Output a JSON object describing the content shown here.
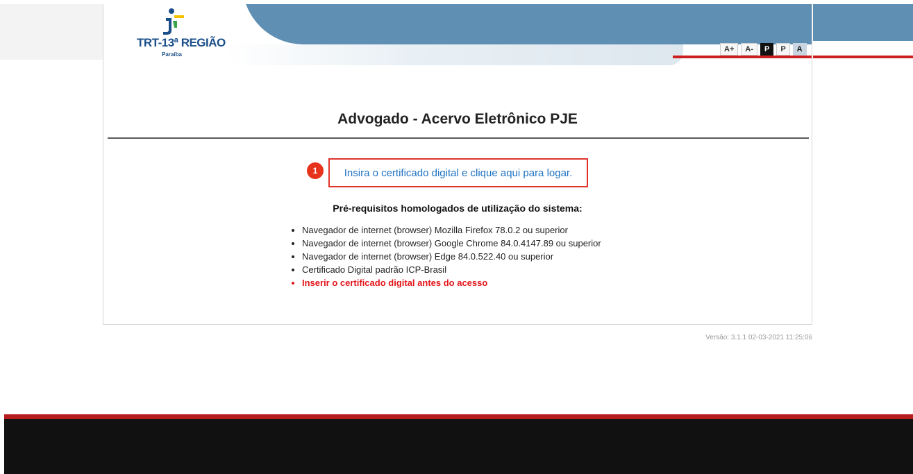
{
  "header": {
    "logo_text": "TRT-13ª REGIÃO",
    "logo_sub": "Paraíba",
    "font_controls": [
      {
        "label": "A+",
        "name": "increase-font-button",
        "style": "light"
      },
      {
        "label": "A-",
        "name": "decrease-font-button",
        "style": "light"
      },
      {
        "label": "P",
        "name": "dark-mode-button",
        "style": "dark"
      },
      {
        "label": "P",
        "name": "light-mode-button",
        "style": "light"
      },
      {
        "label": "A",
        "name": "contrast-button",
        "style": "contrast"
      }
    ]
  },
  "main": {
    "title": "Advogado - Acervo Eletrônico PJE",
    "step_number": "1",
    "login_link": "Insira o certificado digital e clique aqui para logar.",
    "prereq_title": "Pré-requisitos homologados de utilização do sistema:",
    "prereq_items": [
      "Navegador de internet (browser) Mozilla Firefox 78.0.2 ou superior",
      "Navegador de internet (browser) Google Chrome 84.0.4147.89 ou superior",
      "Navegador de internet (browser) Edge 84.0.522.40 ou superior",
      "Certificado Digital padrão ICP-Brasil"
    ],
    "prereq_warning": "Inserir o certificado digital antes do acesso"
  },
  "version": "Versão: 3.1.1 02-03-2021 11:25:06",
  "colors": {
    "header_blue": "#5f8fb2",
    "accent_red": "#cc1f1f",
    "link_blue": "#1f73c3",
    "warning_red": "#e3161b",
    "footer": "#111111"
  }
}
